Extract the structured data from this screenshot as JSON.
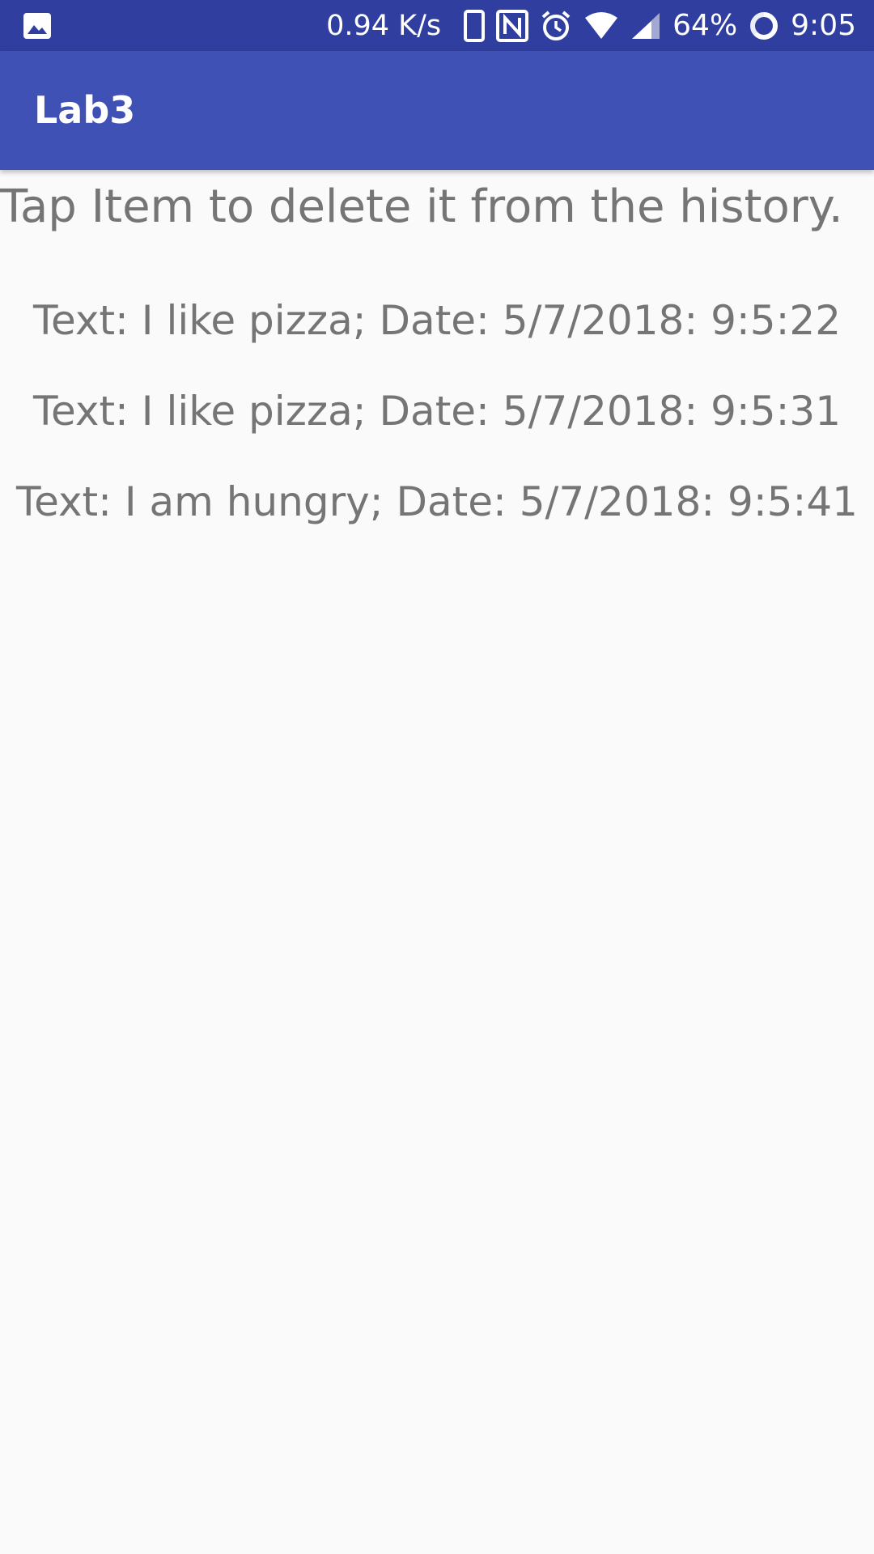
{
  "status_bar": {
    "net_speed": "0.94 K/s",
    "battery": "64%",
    "time": "9:05",
    "icons": [
      "image-icon",
      "phone-icon",
      "nfc-icon",
      "alarm-icon",
      "wifi-icon",
      "signal-icon",
      "battery-ring-icon"
    ],
    "background_color": "#303f9f"
  },
  "app_bar": {
    "title": "Lab3",
    "background_color": "#3f51b5"
  },
  "main": {
    "hint": "Tap Item to delete it from the history.",
    "history": [
      "Text: I like pizza; Date: 5/7/2018: 9:5:22",
      "Text: I like pizza; Date: 5/7/2018: 9:5:31",
      "Text: I am hungry; Date: 5/7/2018: 9:5:41"
    ],
    "text_color": "#757575"
  }
}
